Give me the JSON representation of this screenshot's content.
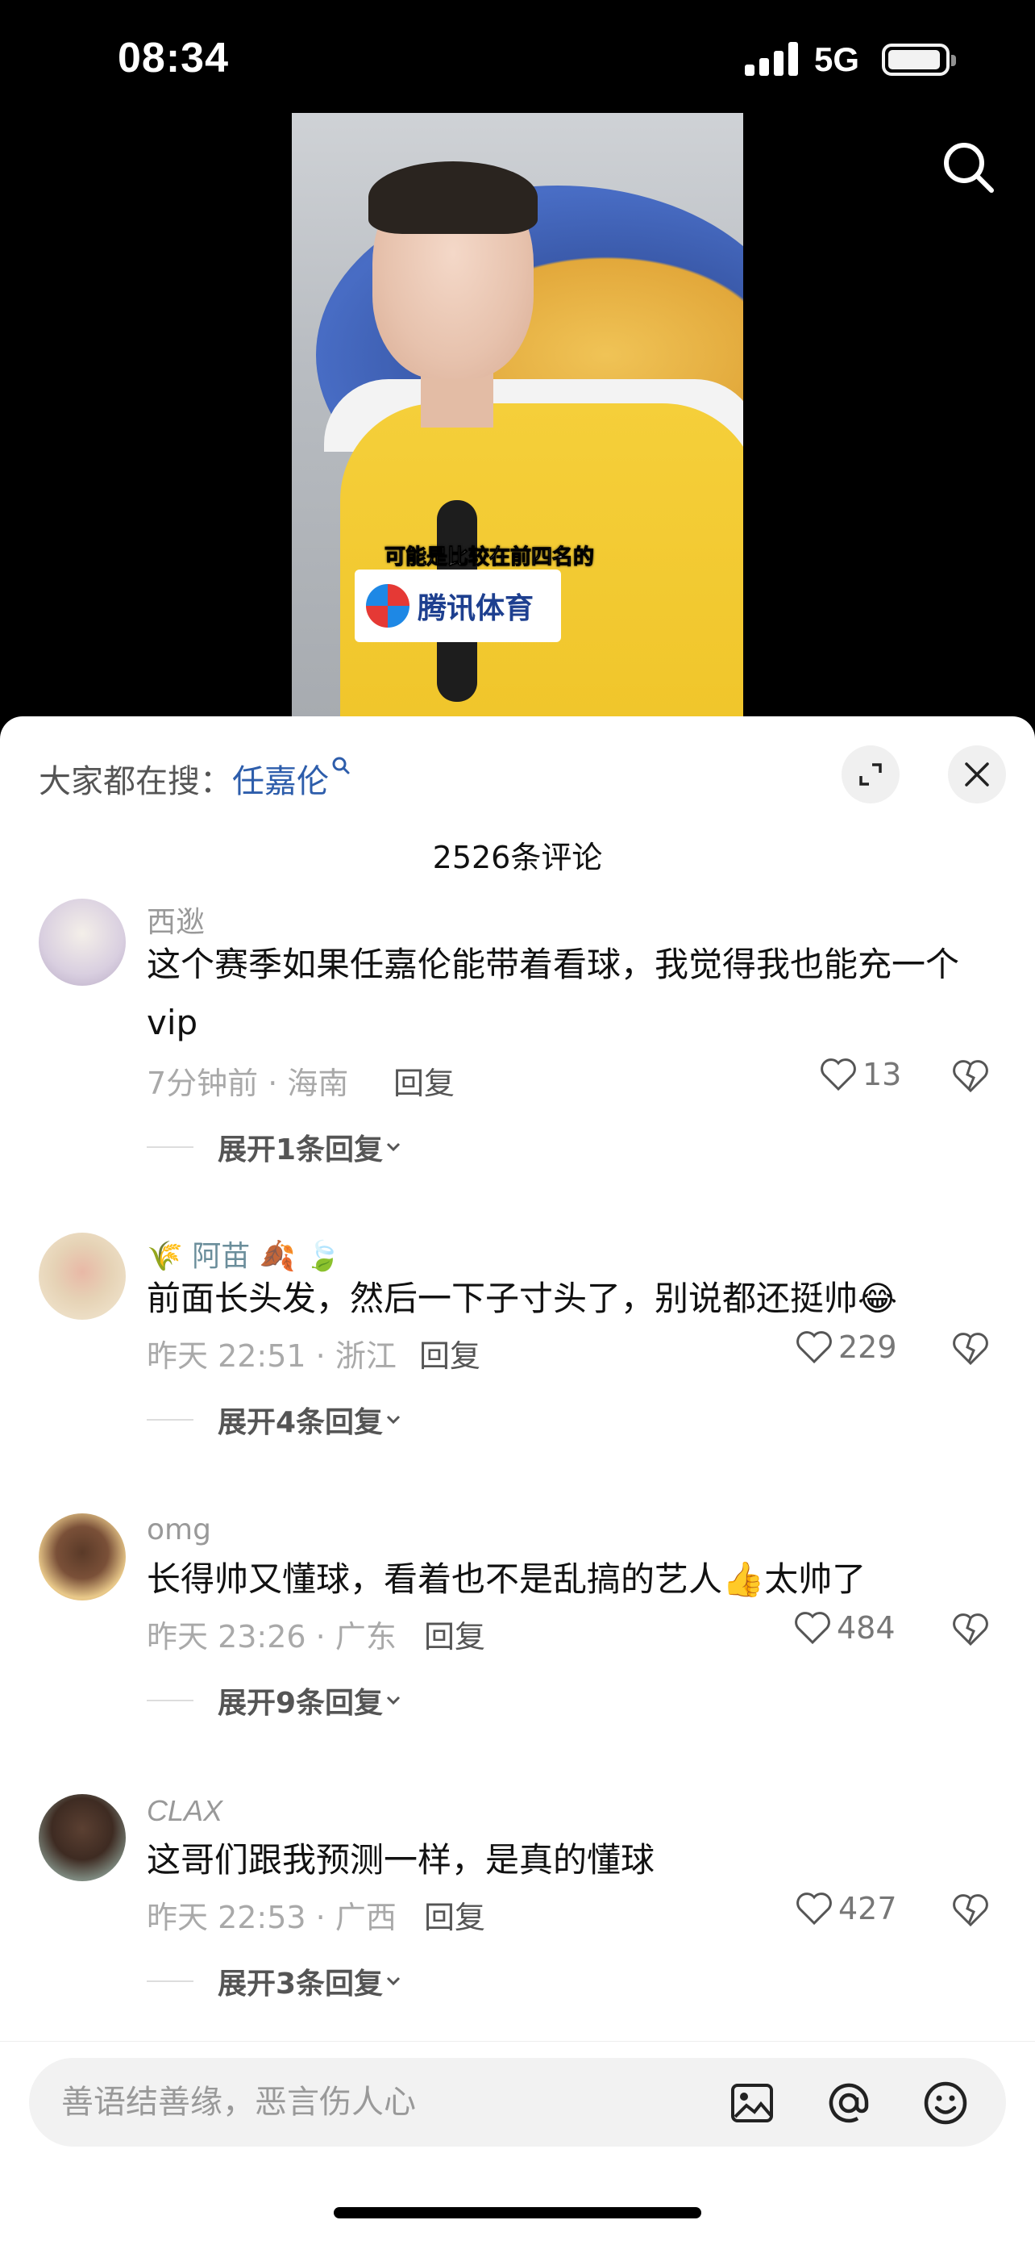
{
  "status_bar": {
    "time": "08:34",
    "network": "5G"
  },
  "video": {
    "caption": "可能是比较在前四名的",
    "logo_text": "腾讯体育"
  },
  "sheet": {
    "trending_label": "大家都在搜：",
    "trending_keyword": "任嘉伦",
    "comment_count": "2526条评论"
  },
  "comments": [
    {
      "name": "西逖",
      "text": "这个赛季如果任嘉伦能带着看球，我觉得我也能充一个vip",
      "meta": "7分钟前 · 海南",
      "reply": "回复",
      "likes": "13",
      "expand": "展开1条回复"
    },
    {
      "name": "阿苗",
      "text": "前面长头发，然后一下子寸头了，别说都还挺帅😂",
      "meta": "昨天 22:51 · 浙江",
      "reply": "回复",
      "likes": "229",
      "expand": "展开4条回复"
    },
    {
      "name": "omg",
      "text": "长得帅又懂球，看着也不是乱搞的艺人👍太帅了",
      "meta": "昨天 23:26 · 广东",
      "reply": "回复",
      "likes": "484",
      "expand": "展开9条回复"
    },
    {
      "name": "CLAX",
      "text": "这哥们跟我预测一样，是真的懂球",
      "meta": "昨天 22:53 · 广西",
      "reply": "回复",
      "likes": "427",
      "expand": "展开3条回复"
    }
  ],
  "input": {
    "placeholder": "善语结善缘，恶言伤人心"
  }
}
